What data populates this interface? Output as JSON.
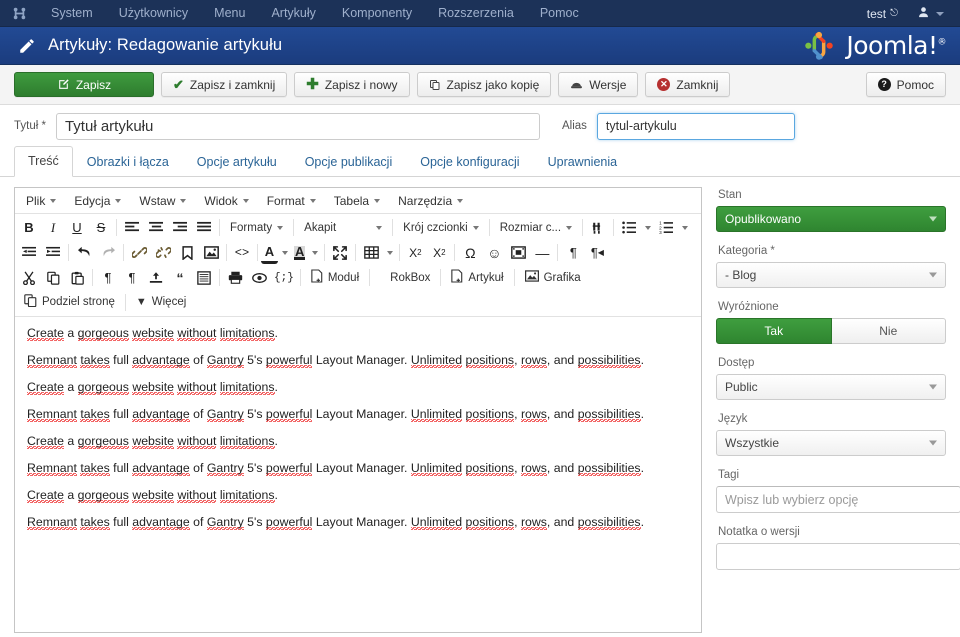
{
  "admin_bar": {
    "logo_icon": "joomla-mark-icon",
    "menu": [
      {
        "label": "System"
      },
      {
        "label": "Użytkownicy"
      },
      {
        "label": "Menu"
      },
      {
        "label": "Artykuły"
      },
      {
        "label": "Komponenty"
      },
      {
        "label": "Rozszerzenia"
      },
      {
        "label": "Pomoc"
      }
    ],
    "site_link": "test",
    "site_link_icon": "external-link-icon",
    "user_icon": "user-icon",
    "user_caret_icon": "chevron-down-icon"
  },
  "header": {
    "icon": "pencil-icon",
    "title": "Artykuły: Redagowanie artykułu",
    "brand": "Joomla!",
    "brand_tm": "®",
    "brand_icon": "joomla-logo-icon",
    "bg_color": "#1d4288"
  },
  "toolbar": {
    "buttons": [
      {
        "label": "Zapisz",
        "icon": "save-pencil-icon",
        "style": "primary",
        "name": "save-button"
      },
      {
        "label": "Zapisz i zamknij",
        "icon": "check-icon",
        "style": "default",
        "name": "save-and-close-button"
      },
      {
        "label": "Zapisz i nowy",
        "icon": "plus-icon",
        "style": "default",
        "name": "save-and-new-button"
      },
      {
        "label": "Zapisz jako kopię",
        "icon": "copy-icon",
        "style": "default",
        "name": "save-as-copy-button"
      },
      {
        "label": "Wersje",
        "icon": "versions-icon",
        "style": "default",
        "name": "versions-button"
      },
      {
        "label": "Zamknij",
        "icon": "close-circle-icon",
        "style": "default",
        "name": "close-button"
      }
    ],
    "help": {
      "label": "Pomoc",
      "icon": "help-circle-icon"
    },
    "save_color": "#2e7d2e"
  },
  "meta": {
    "title_label": "Tytuł *",
    "title_value": "Tytuł artykułu",
    "alias_label": "Alias",
    "alias_value": "tytul-artykulu",
    "alias_focused": true,
    "focus_color": "#5aa7e0"
  },
  "tabs": [
    {
      "label": "Treść",
      "active": true
    },
    {
      "label": "Obrazki i łącza",
      "active": false
    },
    {
      "label": "Opcje artykułu",
      "active": false
    },
    {
      "label": "Opcje publikacji",
      "active": false
    },
    {
      "label": "Opcje konfiguracji",
      "active": false
    },
    {
      "label": "Uprawnienia",
      "active": false
    }
  ],
  "editor": {
    "menubar": [
      {
        "label": "Plik",
        "name": "menu-file"
      },
      {
        "label": "Edycja",
        "name": "menu-edit"
      },
      {
        "label": "Wstaw",
        "name": "menu-insert"
      },
      {
        "label": "Widok",
        "name": "menu-view"
      },
      {
        "label": "Format",
        "name": "menu-format"
      },
      {
        "label": "Tabela",
        "name": "menu-table"
      },
      {
        "label": "Narzędzia",
        "name": "menu-tools"
      }
    ],
    "row1": {
      "bold": "B",
      "italic": "I",
      "underline": "U",
      "strike": "S",
      "formats_label": "Formaty",
      "paragraph_label": "Akapit",
      "fontfamily_label": "Krój czcionki",
      "fontsize_label": "Rozmiar c..."
    },
    "row3": {
      "module_label": "Moduł",
      "rokbox_label": "RokBox",
      "article_label": "Artykuł",
      "graphic_label": "Grafika"
    },
    "row4": {
      "pagebreak_label": "Podziel stronę",
      "readmore_label": "Więcej"
    },
    "content_paragraphs": [
      "Create a gorgeous website without limitations.",
      "Remnant takes full advantage of Gantry 5's powerful Layout Manager. Unlimited positions, rows, and possibilities.",
      "Create a gorgeous website without limitations.",
      "Remnant takes full advantage of Gantry 5's powerful Layout Manager. Unlimited positions, rows, and possibilities.",
      "Create a gorgeous website without limitations.",
      "Remnant takes full advantage of Gantry 5's powerful Layout Manager. Unlimited positions, rows, and possibilities.",
      "Create a gorgeous website without limitations.",
      "Remnant takes full advantage of Gantry 5's powerful Layout Manager. Unlimited positions, rows, and possibilities."
    ]
  },
  "sidebar": {
    "status": {
      "label": "Stan",
      "value": "Opublikowano",
      "color": "#2f8530"
    },
    "category": {
      "label": "Kategoria *",
      "value": "- Blog"
    },
    "featured": {
      "label": "Wyróżnione",
      "yes": "Tak",
      "no": "Nie",
      "selected": "Tak"
    },
    "access": {
      "label": "Dostęp",
      "value": "Public"
    },
    "language": {
      "label": "Język",
      "value": "Wszystkie"
    },
    "tags": {
      "label": "Tagi",
      "placeholder": "Wpisz lub wybierz opcję",
      "value": ""
    },
    "version_note": {
      "label": "Notatka o wersji",
      "value": ""
    }
  }
}
